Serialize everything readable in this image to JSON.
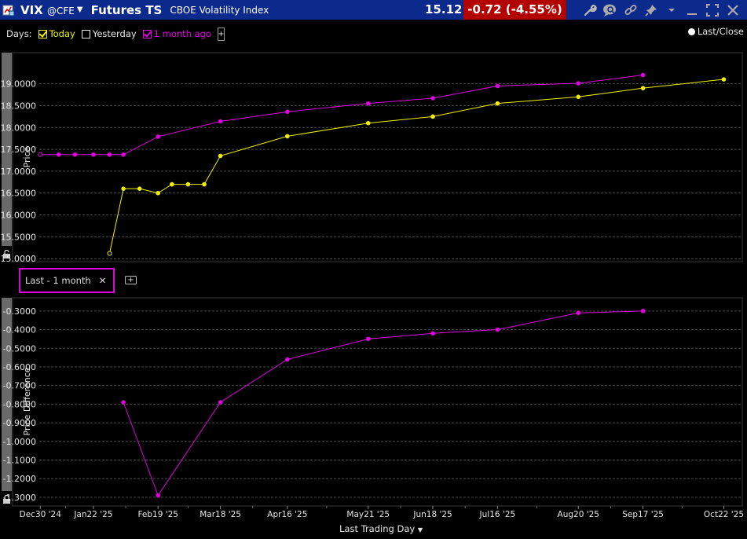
{
  "titlebar": {
    "symbol": "VIX",
    "exchange": "@CFE",
    "app_title": "Futures TS",
    "description": "CBOE Volatility Index",
    "last_price": "15.12",
    "change": "-0.72 (-4.55%)",
    "change_color": "#b30000",
    "bar_color": "#0b2a8c",
    "icons": [
      "app-icon",
      "dropdown-arrow-icon",
      "wrench-icon",
      "chat-search-icon",
      "link-icon",
      "pin-icon",
      "more-chevron-icon",
      "minimize-icon",
      "restore-icon",
      "close-icon"
    ]
  },
  "legend": {
    "days_label": "Days:",
    "items": [
      {
        "label": "Today",
        "checked": true,
        "color": "#f0f000"
      },
      {
        "label": "Yesterday",
        "checked": false,
        "color": "#ffffff"
      },
      {
        "label": "1 month ago",
        "checked": true,
        "color": "#e000e0"
      }
    ],
    "add_label": "+",
    "mode_label": "Last/Close"
  },
  "diff_tab": {
    "label": "Last - 1 month",
    "close_glyph": "✕",
    "add_label": "+"
  },
  "x_axis_title": "Last Trading Day",
  "chart_data": [
    {
      "type": "line",
      "ylabel": "Price",
      "xlabel": "Last Trading Day",
      "xlim": [
        "2024-12-18",
        "2025-10-30"
      ],
      "x_ticks": [
        "Dec30 '24",
        "Jan22 '25",
        "Feb19 '25",
        "Mar18 '25",
        "Apr16 '25",
        "May21 '25",
        "Jun18 '25",
        "Jul16 '25",
        "Aug20 '25",
        "Sep17 '25",
        "Oct22 '25"
      ],
      "x_tick_dates": [
        "2024-12-30",
        "2025-01-22",
        "2025-02-19",
        "2025-03-18",
        "2025-04-16",
        "2025-05-21",
        "2025-06-18",
        "2025-07-16",
        "2025-08-20",
        "2025-09-17",
        "2025-10-22"
      ],
      "ylim": [
        14.95,
        19.55
      ],
      "y_ticks": [
        "15.0000",
        "15.5000",
        "16.0000",
        "16.5000",
        "17.0000",
        "17.5000",
        "18.0000",
        "18.5000",
        "19.0000"
      ],
      "y_tick_values": [
        15.0,
        15.5,
        16.0,
        16.5,
        17.0,
        17.5,
        18.0,
        18.5,
        19.0
      ],
      "grid": true,
      "series": [
        {
          "name": "Today",
          "color": "#f0f000",
          "x": [
            "2025-01-29",
            "2025-02-04",
            "2025-02-11",
            "2025-02-19",
            "2025-02-25",
            "2025-03-04",
            "2025-03-11",
            "2025-03-18",
            "2025-04-16",
            "2025-05-21",
            "2025-06-18",
            "2025-07-16",
            "2025-08-20",
            "2025-09-17",
            "2025-10-22"
          ],
          "y": [
            15.12,
            16.6,
            16.6,
            16.5,
            16.7,
            16.7,
            16.7,
            17.35,
            17.8,
            18.1,
            18.25,
            18.55,
            18.7,
            18.9,
            19.1
          ]
        },
        {
          "name": "1 month ago",
          "color": "#e000e0",
          "x": [
            "2024-12-30",
            "2025-01-07",
            "2025-01-14",
            "2025-01-22",
            "2025-01-29",
            "2025-02-04",
            "2025-02-19",
            "2025-03-18",
            "2025-04-16",
            "2025-05-21",
            "2025-06-18",
            "2025-07-16",
            "2025-08-20",
            "2025-09-17"
          ],
          "y": [
            17.38,
            17.38,
            17.38,
            17.38,
            17.38,
            17.38,
            17.79,
            18.14,
            18.36,
            18.55,
            18.67,
            18.95,
            19.01,
            19.2
          ]
        }
      ]
    },
    {
      "type": "line",
      "ylabel": "Price Difference",
      "xlabel": "Last Trading Day",
      "xlim": [
        "2024-12-18",
        "2025-10-30"
      ],
      "x_ticks": [
        "Dec30 '24",
        "Jan22 '25",
        "Feb19 '25",
        "Mar18 '25",
        "Apr16 '25",
        "May21 '25",
        "Jun18 '25",
        "Jul16 '25",
        "Aug20 '25",
        "Sep17 '25",
        "Oct22 '25"
      ],
      "ylim": [
        -1.33,
        -0.25
      ],
      "y_ticks": [
        "-0.3000",
        "-0.4000",
        "-0.5000",
        "-0.6000",
        "-0.7000",
        "-0.8000",
        "-0.9000",
        "-1.0000",
        "-1.1000",
        "-1.2000",
        "-1.3000"
      ],
      "y_tick_values": [
        -0.3,
        -0.4,
        -0.5,
        -0.6,
        -0.7,
        -0.8,
        -0.9,
        -1.0,
        -1.1,
        -1.2,
        -1.3
      ],
      "grid": true,
      "series": [
        {
          "name": "Last - 1 month",
          "color": "#e000e0",
          "x": [
            "2025-02-04",
            "2025-02-19",
            "2025-03-18",
            "2025-04-16",
            "2025-05-21",
            "2025-06-18",
            "2025-07-16",
            "2025-08-20",
            "2025-09-17"
          ],
          "y": [
            -0.79,
            -1.29,
            -0.79,
            -0.56,
            -0.45,
            -0.42,
            -0.4,
            -0.31,
            -0.3
          ]
        }
      ]
    }
  ]
}
